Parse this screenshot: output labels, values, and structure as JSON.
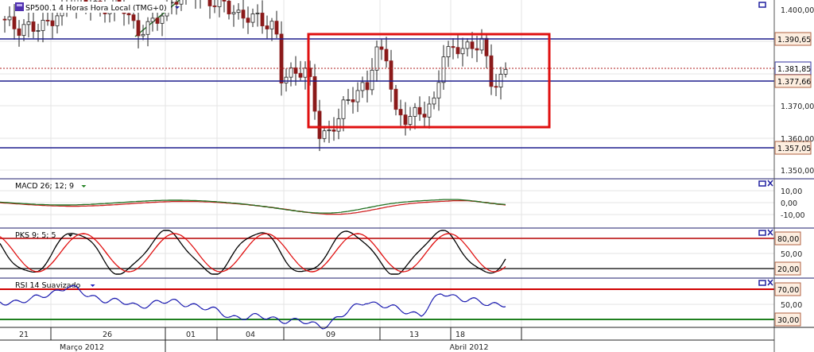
{
  "main_panel": {
    "legend": "SP500.1 4 Horas Hora Local (TMG+0)",
    "axis_ticks": [
      "1.400,00",
      "1.370,00",
      "1.360,00",
      "1.350,00"
    ],
    "price_tags": [
      {
        "label": "1.390,65",
        "kind": "level"
      },
      {
        "label": "1.381,85",
        "kind": "current"
      },
      {
        "label": "1.377,66",
        "kind": "level"
      },
      {
        "label": "1.357,05",
        "kind": "level"
      }
    ]
  },
  "indicators": [
    {
      "title": "MACD 26; 12; 9",
      "axis_ticks": [
        "10,00",
        "0,00",
        "-10,00"
      ]
    },
    {
      "title": "PKS 9; 5; 5",
      "axis_ticks": [
        "50,00"
      ],
      "level_tags": [
        {
          "label": "80,00",
          "color": "#c84040"
        },
        {
          "label": "20,00",
          "color": "#606060"
        }
      ]
    },
    {
      "title": "RSI 14 Suavizado",
      "axis_ticks": [
        "50,00"
      ],
      "level_tags": [
        {
          "label": "70,00",
          "color": "#d00000"
        },
        {
          "label": "30,00",
          "color": "#208020"
        }
      ]
    }
  ],
  "date_axis": {
    "days": [
      "21",
      "26",
      "01",
      "04",
      "09",
      "13",
      "18"
    ],
    "months": [
      "Março 2012",
      "Abril 2012"
    ]
  }
}
